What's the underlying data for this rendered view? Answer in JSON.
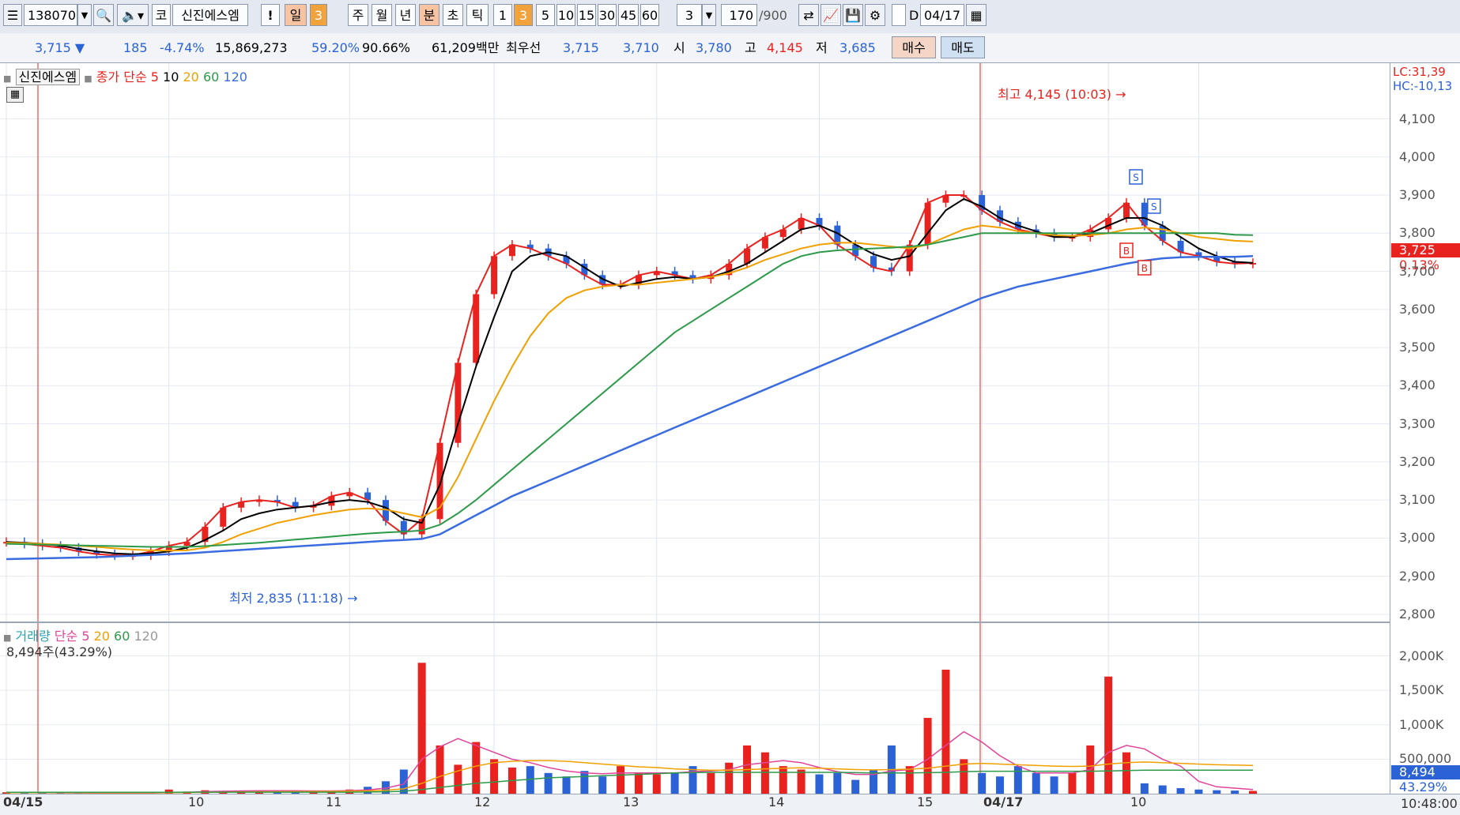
{
  "toolbar": {
    "code": "138070",
    "market_button": "코",
    "stock_name": "신진에스엠",
    "alert_button": "!",
    "periods": [
      "일",
      "3",
      "주",
      "월",
      "년",
      "분",
      "초",
      "틱"
    ],
    "intervals": [
      "1",
      "3",
      "5",
      "10",
      "15",
      "30",
      "45",
      "60"
    ],
    "multiplier": "3",
    "count": "170",
    "count_total": "/900",
    "date_label": "D",
    "date": "04/17"
  },
  "quote": {
    "price": "3,715",
    "change": "185",
    "change_pct": "-4.74%",
    "volume": "15,869,273",
    "vol_ratio": "59.20%",
    "turnover": "90.66%",
    "trade_value": "61,209백만",
    "best_label": "최우선",
    "ask": "3,715",
    "bid": "3,710",
    "open_label": "시",
    "open": "3,780",
    "high_label": "고",
    "high": "4,145",
    "low_label": "저",
    "low": "3,685",
    "buy_button": "매수",
    "sell_button": "매도"
  },
  "price_legend": {
    "name": "신진에스엠",
    "close_label": "종가 단순",
    "ma": [
      "5",
      "10",
      "20",
      "60",
      "120"
    ]
  },
  "volume_legend": {
    "label": "거래량",
    "simple": "단순",
    "ma": [
      "5",
      "20",
      "60",
      "120"
    ],
    "current": "8,494주(43.29%)"
  },
  "right_info": {
    "lc": "LC:31,39",
    "hc": "HC:-10,13",
    "price_tag": "3,725",
    "price_pct": "0.13%",
    "vol_tag": "8,494",
    "vol_pct": "43.29%",
    "time": "10:48:00"
  },
  "annotations": {
    "high": "최고 4,145 (10:03)",
    "low": "최저 2,835 (11:18)",
    "buy_marker": "B",
    "sell_marker": "S"
  },
  "colors": {
    "up": "#e8231f",
    "down": "#2b62d6",
    "ma5": "#e8231f",
    "ma10": "#000000",
    "ma20": "#f0a000",
    "ma60": "#2d9a4a",
    "ma120": "#3a6ce0",
    "vol_ma5": "#e0449a"
  },
  "chart_data": [
    {
      "type": "candlestick",
      "title": "신진에스엠",
      "x_tick_labels": [
        "04/15",
        "10",
        "11",
        "12",
        "13",
        "14",
        "15",
        "04/17",
        "10"
      ],
      "y_ticks": [
        "4,100",
        "4,000",
        "3,900",
        "3,800",
        "3,700",
        "3,600",
        "3,500",
        "3,400",
        "3,300",
        "3,200",
        "3,100",
        "3,000",
        "2,900",
        "2,800"
      ],
      "ylim": [
        2775,
        4215
      ],
      "series": [
        {
          "name": "5",
          "role": "ma5",
          "values": [
            2990,
            2985,
            2980,
            2975,
            2965,
            2958,
            2955,
            2955,
            2965,
            2980,
            2990,
            3030,
            3080,
            3095,
            3100,
            3095,
            3080,
            3085,
            3110,
            3120,
            3100,
            3045,
            3010,
            3050,
            3250,
            3460,
            3640,
            3740,
            3770,
            3760,
            3740,
            3720,
            3690,
            3665,
            3665,
            3690,
            3700,
            3690,
            3680,
            3690,
            3720,
            3760,
            3790,
            3810,
            3840,
            3820,
            3770,
            3740,
            3710,
            3700,
            3770,
            3880,
            3900,
            3900,
            3860,
            3830,
            3810,
            3800,
            3790,
            3790,
            3810,
            3840,
            3880,
            3820,
            3780,
            3750,
            3740,
            3725,
            3720,
            3722
          ]
        },
        {
          "name": "10",
          "role": "ma10",
          "values": [
            2990,
            2988,
            2985,
            2980,
            2972,
            2965,
            2960,
            2958,
            2960,
            2965,
            2975,
            2995,
            3020,
            3050,
            3065,
            3075,
            3080,
            3085,
            3095,
            3100,
            3095,
            3080,
            3050,
            3040,
            3140,
            3300,
            3450,
            3580,
            3700,
            3740,
            3750,
            3740,
            3710,
            3680,
            3660,
            3670,
            3680,
            3685,
            3680,
            3685,
            3700,
            3720,
            3750,
            3780,
            3810,
            3820,
            3800,
            3770,
            3745,
            3730,
            3740,
            3800,
            3860,
            3890,
            3870,
            3840,
            3820,
            3805,
            3790,
            3790,
            3800,
            3820,
            3840,
            3840,
            3820,
            3790,
            3760,
            3740,
            3725,
            3722
          ]
        },
        {
          "name": "20",
          "role": "ma20",
          "values": [
            2988,
            2987,
            2985,
            2983,
            2980,
            2977,
            2973,
            2970,
            2968,
            2967,
            2968,
            2975,
            2990,
            3010,
            3025,
            3040,
            3050,
            3060,
            3068,
            3075,
            3078,
            3075,
            3065,
            3055,
            3080,
            3160,
            3260,
            3360,
            3450,
            3530,
            3590,
            3630,
            3650,
            3660,
            3665,
            3665,
            3670,
            3675,
            3680,
            3685,
            3695,
            3710,
            3730,
            3745,
            3760,
            3770,
            3775,
            3775,
            3770,
            3765,
            3760,
            3770,
            3790,
            3810,
            3820,
            3815,
            3805,
            3800,
            3795,
            3793,
            3795,
            3800,
            3810,
            3815,
            3810,
            3800,
            3790,
            3785,
            3780,
            3778
          ]
        },
        {
          "name": "60",
          "role": "ma60",
          "values": [
            2985,
            2984,
            2983,
            2982,
            2981,
            2980,
            2979,
            2978,
            2977,
            2977,
            2977,
            2979,
            2982,
            2985,
            2988,
            2992,
            2996,
            3000,
            3004,
            3008,
            3012,
            3015,
            3017,
            3020,
            3035,
            3065,
            3100,
            3140,
            3180,
            3220,
            3260,
            3300,
            3340,
            3380,
            3420,
            3460,
            3500,
            3540,
            3570,
            3600,
            3630,
            3660,
            3690,
            3720,
            3740,
            3750,
            3755,
            3758,
            3760,
            3762,
            3765,
            3770,
            3780,
            3790,
            3800,
            3800,
            3800,
            3800,
            3800,
            3800,
            3800,
            3800,
            3800,
            3800,
            3800,
            3800,
            3800,
            3800,
            3796,
            3795
          ]
        },
        {
          "name": "120",
          "role": "ma120",
          "values": [
            2945,
            2946,
            2947,
            2948,
            2949,
            2950,
            2952,
            2954,
            2956,
            2958,
            2960,
            2963,
            2966,
            2969,
            2972,
            2975,
            2978,
            2981,
            2984,
            2987,
            2990,
            2993,
            2995,
            2998,
            3010,
            3035,
            3060,
            3085,
            3110,
            3130,
            3150,
            3170,
            3190,
            3210,
            3230,
            3250,
            3270,
            3290,
            3310,
            3330,
            3350,
            3370,
            3390,
            3410,
            3430,
            3450,
            3470,
            3490,
            3510,
            3530,
            3550,
            3570,
            3590,
            3610,
            3630,
            3645,
            3660,
            3670,
            3680,
            3690,
            3700,
            3710,
            3720,
            3728,
            3734,
            3737,
            3738,
            3738,
            3738,
            3740
          ]
        }
      ],
      "annotations": [
        {
          "text": "최고 4,145 (10:03)",
          "value": 4145
        },
        {
          "text": "최저 2,835 (11:18)",
          "value": 2835
        }
      ]
    },
    {
      "type": "bar",
      "title": "거래량",
      "y_ticks": [
        "2,000K",
        "1,500K",
        "1,000K",
        "500,000"
      ],
      "ylim": [
        0,
        2350000
      ],
      "values": [
        20000,
        15000,
        10000,
        8000,
        5000,
        5000,
        8000,
        10000,
        10000,
        60000,
        30000,
        50000,
        40000,
        40000,
        45000,
        40000,
        40000,
        35000,
        40000,
        60000,
        100000,
        180000,
        350000,
        1900000,
        700000,
        420000,
        750000,
        500000,
        380000,
        400000,
        300000,
        250000,
        330000,
        250000,
        400000,
        300000,
        280000,
        300000,
        400000,
        300000,
        450000,
        700000,
        600000,
        400000,
        350000,
        280000,
        300000,
        200000,
        350000,
        700000,
        400000,
        1100000,
        1800000,
        500000,
        300000,
        250000,
        400000,
        300000,
        250000,
        300000,
        700000,
        1700000,
        600000,
        150000,
        120000,
        80000,
        60000,
        50000,
        45000,
        40000
      ],
      "series": [
        {
          "name": "5",
          "role": "vol_ma5",
          "values": [
            20000,
            20000,
            15000,
            12000,
            10000,
            9000,
            8000,
            8000,
            9000,
            15000,
            20000,
            30000,
            35000,
            40000,
            42000,
            42000,
            42000,
            40000,
            40000,
            45000,
            55000,
            80000,
            140000,
            500000,
            680000,
            800000,
            700000,
            600000,
            500000,
            450000,
            380000,
            330000,
            300000,
            290000,
            300000,
            300000,
            300000,
            300000,
            320000,
            330000,
            350000,
            420000,
            450000,
            480000,
            450000,
            380000,
            320000,
            280000,
            280000,
            330000,
            350000,
            500000,
            700000,
            900000,
            750000,
            550000,
            400000,
            300000,
            300000,
            300000,
            350000,
            600000,
            700000,
            650000,
            500000,
            400000,
            180000,
            100000,
            80000,
            60000
          ]
        },
        {
          "name": "20",
          "role": "vol_ma20",
          "values": [
            15000,
            15000,
            15000,
            14000,
            14000,
            13000,
            13000,
            13000,
            13000,
            15000,
            17000,
            20000,
            22000,
            25000,
            27000,
            29000,
            30000,
            32000,
            33000,
            35000,
            40000,
            50000,
            70000,
            150000,
            250000,
            330000,
            400000,
            450000,
            470000,
            480000,
            480000,
            470000,
            450000,
            430000,
            410000,
            390000,
            380000,
            360000,
            350000,
            340000,
            340000,
            350000,
            360000,
            370000,
            375000,
            370000,
            360000,
            350000,
            345000,
            350000,
            355000,
            370000,
            400000,
            430000,
            440000,
            430000,
            420000,
            410000,
            400000,
            395000,
            400000,
            430000,
            450000,
            460000,
            450000,
            440000,
            430000,
            420000,
            415000,
            410000
          ]
        },
        {
          "name": "60",
          "role": "vol_ma60",
          "values": [
            20000,
            20000,
            20000,
            20000,
            20000,
            20000,
            20000,
            20000,
            20000,
            20000,
            22000,
            22000,
            22000,
            22000,
            22000,
            22000,
            22000,
            22000,
            22000,
            22000,
            24000,
            28000,
            35000,
            60000,
            90000,
            120000,
            150000,
            170000,
            190000,
            210000,
            230000,
            240000,
            250000,
            260000,
            270000,
            280000,
            290000,
            300000,
            305000,
            310000,
            310000,
            310000,
            310000,
            310000,
            310000,
            310000,
            310000,
            305000,
            300000,
            300000,
            300000,
            305000,
            310000,
            320000,
            325000,
            325000,
            325000,
            325000,
            325000,
            325000,
            325000,
            330000,
            335000,
            340000,
            340000,
            340000,
            340000,
            340000,
            340000,
            340000
          ]
        }
      ]
    }
  ]
}
